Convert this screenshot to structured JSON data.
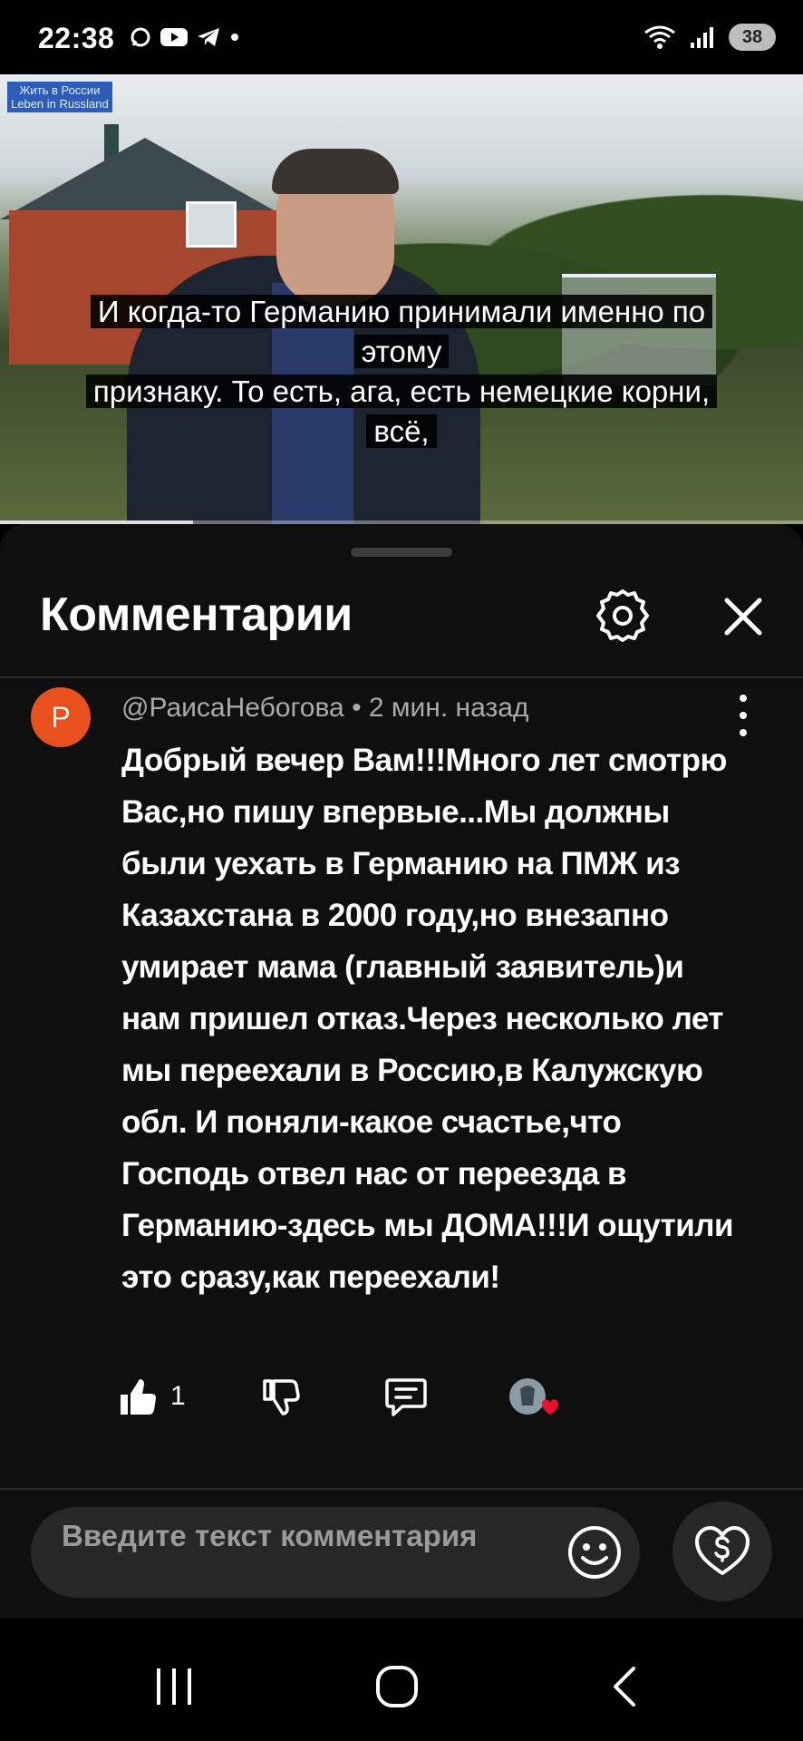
{
  "status_bar": {
    "time": "22:38",
    "left_icons": [
      "chat-bubble-icon",
      "youtube-icon",
      "telegram-icon",
      "dot-icon"
    ],
    "right_icons": [
      "wifi-icon",
      "signal-icon"
    ],
    "battery": "38"
  },
  "video": {
    "channel_badge_line1": "Жить в России",
    "channel_badge_line2": "Leben in Russland",
    "subtitle_line1": "И когда-то Германию принимали именно по",
    "subtitle_line2": "этому",
    "subtitle_line3": "признаку. То есть, ага, есть немецкие корни,",
    "subtitle_line4": "всё,",
    "progress": 0.24
  },
  "comments_panel": {
    "title": "Комментарии",
    "settings_icon": "gear-icon",
    "close_icon": "close-icon"
  },
  "comment": {
    "avatar_letter": "Р",
    "avatar_color": "#e8501e",
    "meta": "@РаисаНебогова • 2 мин. назад",
    "text": "Добрый вечер Вам!!!Много лет смотрю Вас,но пишу впервые...Мы должны были уехать в Германию на ПМЖ из Казахстана в 2000 году,но внезапно умирает мама (главный заявитель)и нам пришел отказ.Через несколько лет мы переехали в Россию,в Калужскую обл. И поняли-какое счастье,что Господь отвел нас от переезда в Германию-здесь мы ДОМА!!!И ощутили это сразу,как переехали!",
    "like_count": "1"
  },
  "composer": {
    "placeholder": "Введите текст комментария"
  },
  "colors": {
    "panel_bg": "#0f0f0f",
    "input_bg": "#272727",
    "heart": "#e8112d"
  }
}
